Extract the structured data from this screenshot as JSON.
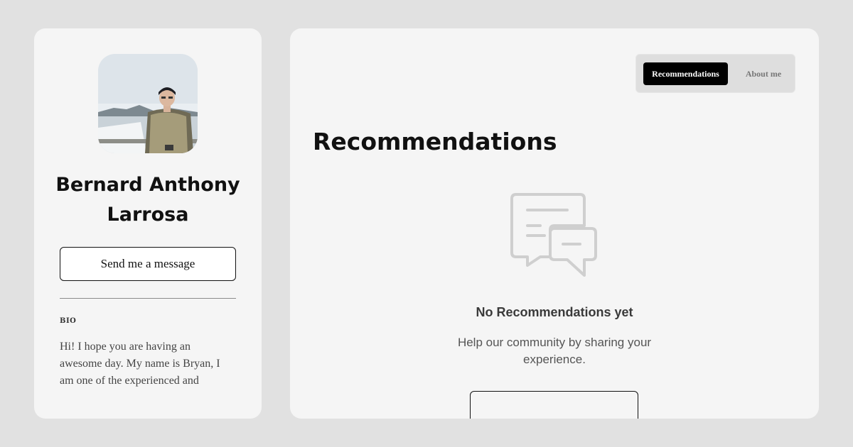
{
  "profile": {
    "name": "Bernard Anthony Larrosa",
    "message_button_label": "Send me a message",
    "bio_label": "BIO",
    "bio_text": "Hi! I hope you are having an awesome day. My name is Bryan, I am one of the experienced and"
  },
  "tabs": [
    {
      "label": "Recommendations",
      "active": true
    },
    {
      "label": "About me",
      "active": false
    }
  ],
  "main": {
    "title": "Recommendations",
    "empty_state": {
      "icon": "chat-bubbles-icon",
      "title": "No Recommendations yet",
      "subtitle": "Help our community by sharing your experience."
    }
  },
  "colors": {
    "page_background": "#e1e1e1",
    "card_background": "#f5f5f5",
    "active_tab": "#000000",
    "icon_stroke": "#cfcfcf"
  }
}
